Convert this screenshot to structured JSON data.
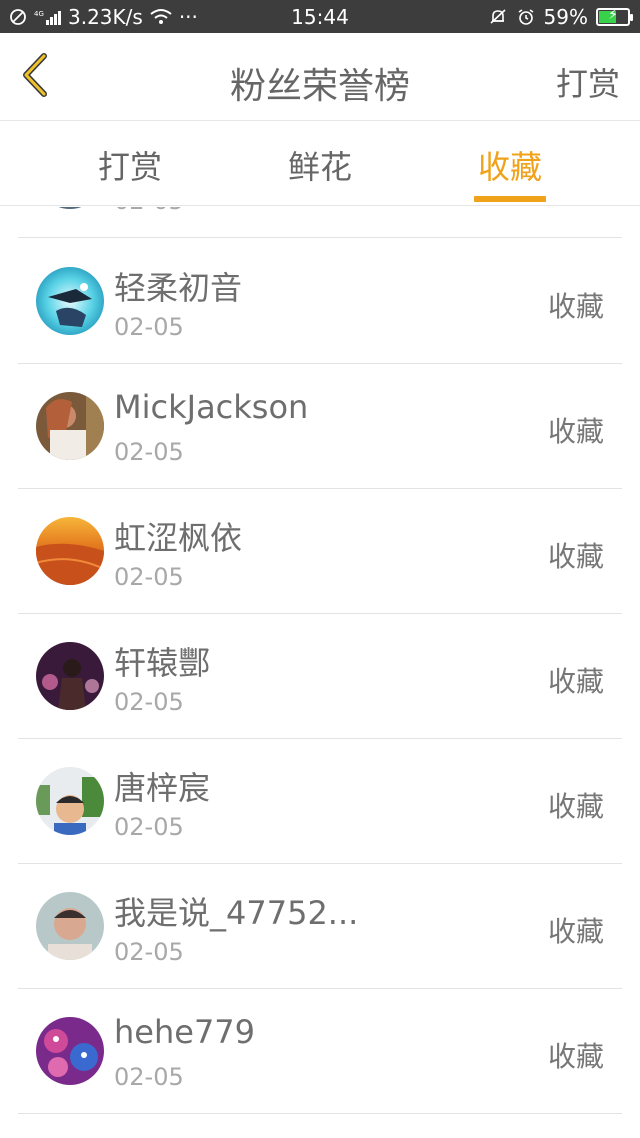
{
  "status_bar": {
    "network": "4G",
    "speed": "3.23K/s",
    "more": "···",
    "time": "15:44",
    "battery_percent": "59%",
    "battery_level": 0.59
  },
  "header": {
    "title": "粉丝荣誉榜",
    "action_label": "打赏",
    "icons": {
      "back": "chevron-left-icon"
    },
    "accent_color": "#f0a21a"
  },
  "tabs": [
    {
      "label": "打赏",
      "active": false
    },
    {
      "label": "鲜花",
      "active": false
    },
    {
      "label": "收藏",
      "active": true
    }
  ],
  "list": {
    "partial_top_row": {
      "date": "02-05"
    },
    "rows": [
      {
        "name": "轻柔初音",
        "date": "02-05",
        "action": "收藏"
      },
      {
        "name": "MickJackson",
        "date": "02-05",
        "action": "收藏"
      },
      {
        "name": "虹涩枫依",
        "date": "02-05",
        "action": "收藏"
      },
      {
        "name": "轩辕酆",
        "date": "02-05",
        "action": "收藏"
      },
      {
        "name": "唐梓宸",
        "date": "02-05",
        "action": "收藏"
      },
      {
        "name": "我是说_47752...",
        "date": "02-05",
        "action": "收藏"
      },
      {
        "name": "hehe779",
        "date": "02-05",
        "action": "收藏"
      }
    ]
  }
}
